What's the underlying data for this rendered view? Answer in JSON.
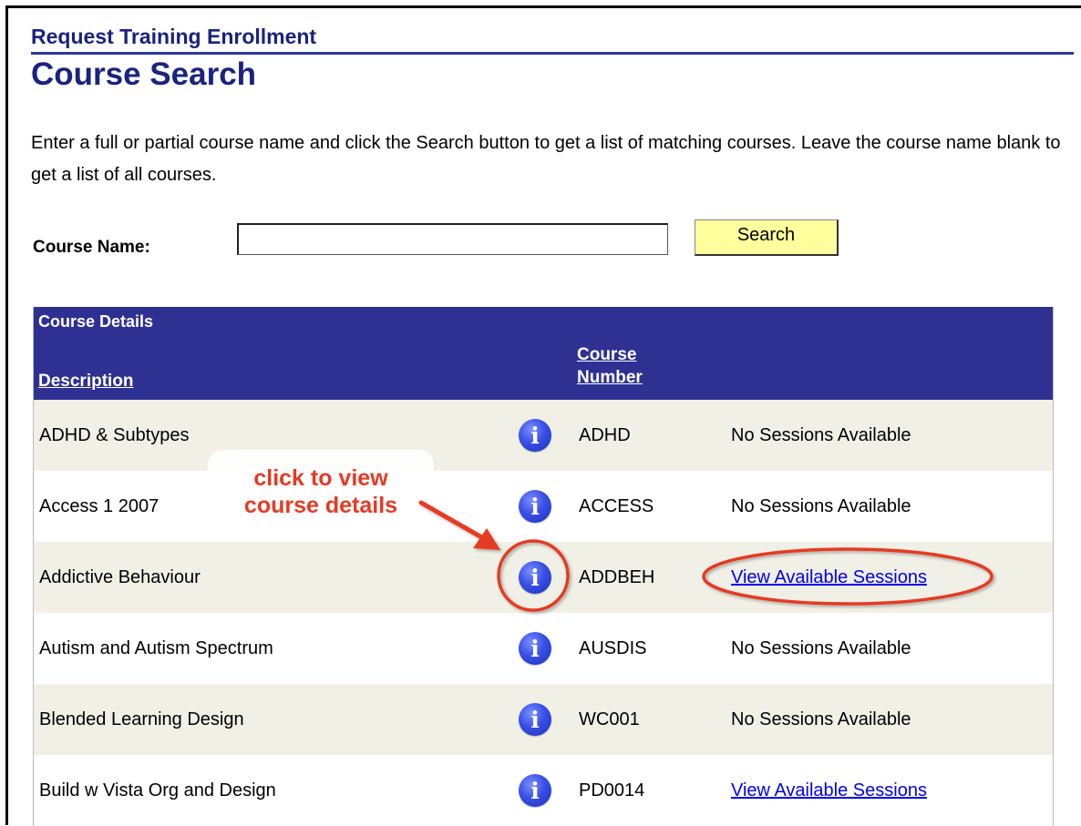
{
  "header": {
    "pre_title": "Request Training Enrollment",
    "title": "Course Search"
  },
  "instructions": "Enter a full or partial course name and click the Search button to get a list of matching courses.  Leave the course name blank to get a list of all courses.",
  "search": {
    "label": "Course Name:",
    "value": "",
    "placeholder": "",
    "button_label": "Search"
  },
  "grid": {
    "caption": "Course Details",
    "columns": {
      "description": "Description",
      "course_number_line1": "Course",
      "course_number_line2": "Number"
    },
    "rows": [
      {
        "description": "ADHD & Subtypes",
        "number": "ADHD",
        "sessions": "No Sessions Available"
      },
      {
        "description": "Access 1 2007",
        "number": "ACCESS",
        "sessions": "No Sessions Available"
      },
      {
        "description": "Addictive Behaviour",
        "number": "ADDBEH",
        "sessions": "View Available Sessions"
      },
      {
        "description": "Autism and Autism Spectrum",
        "number": "AUSDIS",
        "sessions": "No Sessions Available"
      },
      {
        "description": "Blended Learning Design",
        "number": "WC001",
        "sessions": "No Sessions Available"
      },
      {
        "description": "Build w Vista Org and Design",
        "number": "PD0014",
        "sessions": "View Available Sessions"
      }
    ],
    "info_icon": "i"
  },
  "annotation": {
    "line1": "click to view",
    "line2": "course details",
    "color": "#e53a24"
  },
  "colors": {
    "header_blue": "#2e3192",
    "title_blue": "#1a237e",
    "row_alt": "#f0f0e6",
    "button_yellow": "#ffff9e",
    "link": "#0000ee"
  }
}
